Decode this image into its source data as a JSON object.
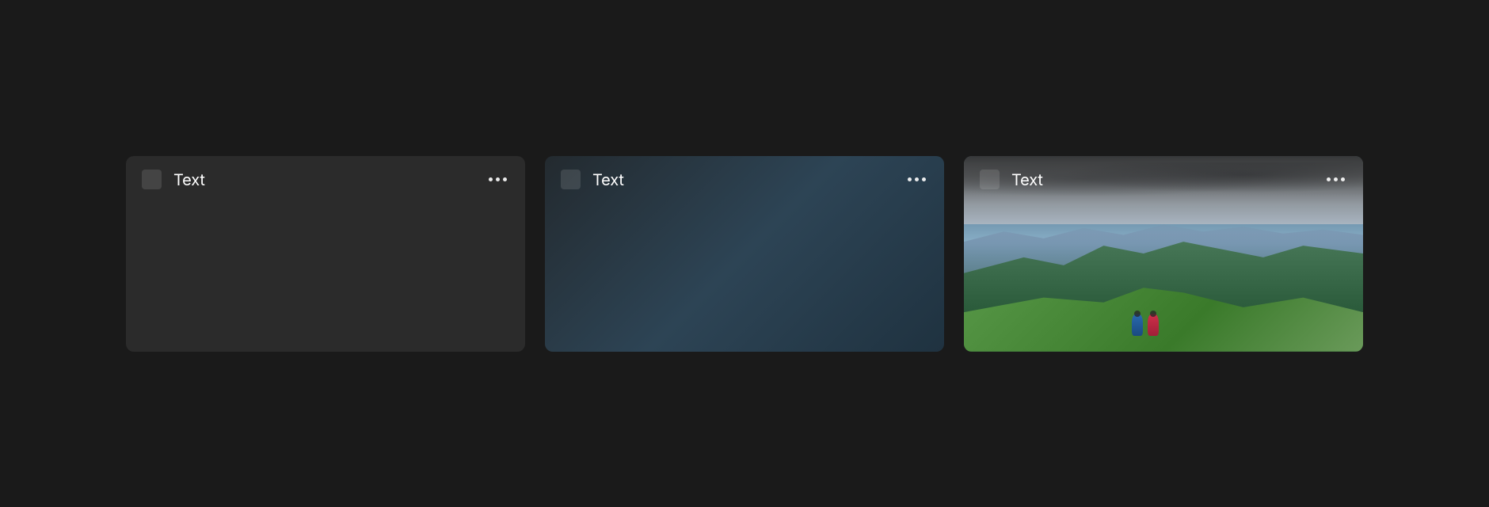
{
  "cards": [
    {
      "title": "Text",
      "variant": "plain"
    },
    {
      "title": "Text",
      "variant": "gradient"
    },
    {
      "title": "Text",
      "variant": "image"
    }
  ]
}
